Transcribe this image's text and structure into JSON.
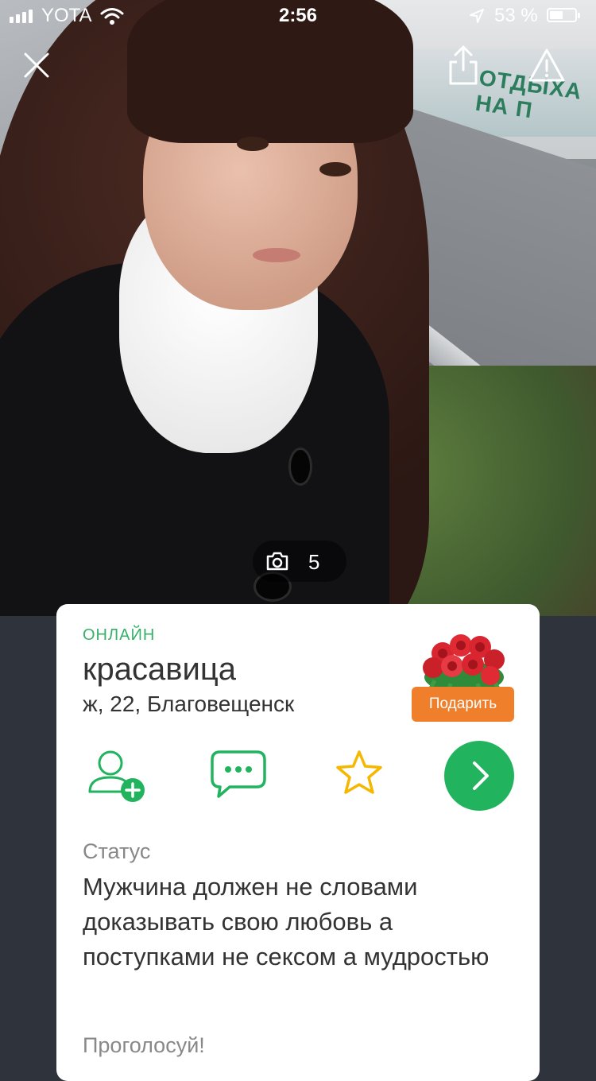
{
  "status_bar": {
    "carrier": "YOTA",
    "time": "2:56",
    "battery": "53 %",
    "battery_level": 0.53
  },
  "photo": {
    "sign_text": "ОТДЫХА НА П",
    "photo_count": "5",
    "icons": [
      "close-icon",
      "share-icon",
      "warning-icon",
      "camera-icon"
    ]
  },
  "profile": {
    "online": "ОНЛАЙН",
    "name": "красавица",
    "meta": "ж, 22, Благовещенск",
    "gift_button": "Подарить",
    "actions": [
      "add-friend-icon",
      "message-icon",
      "star-icon",
      "chevron-right-icon"
    ],
    "status_label": "Статус",
    "status_text": "Мужчина должен не словами доказывать свою любовь а поступками не сексом а мудростью",
    "vote_label": "Проголосуй!"
  },
  "colors": {
    "accent_green": "#22b35e",
    "online_green": "#35b267",
    "gift_orange": "#f07f2c",
    "star_yellow": "#f5b800",
    "background": "#2f333b"
  }
}
